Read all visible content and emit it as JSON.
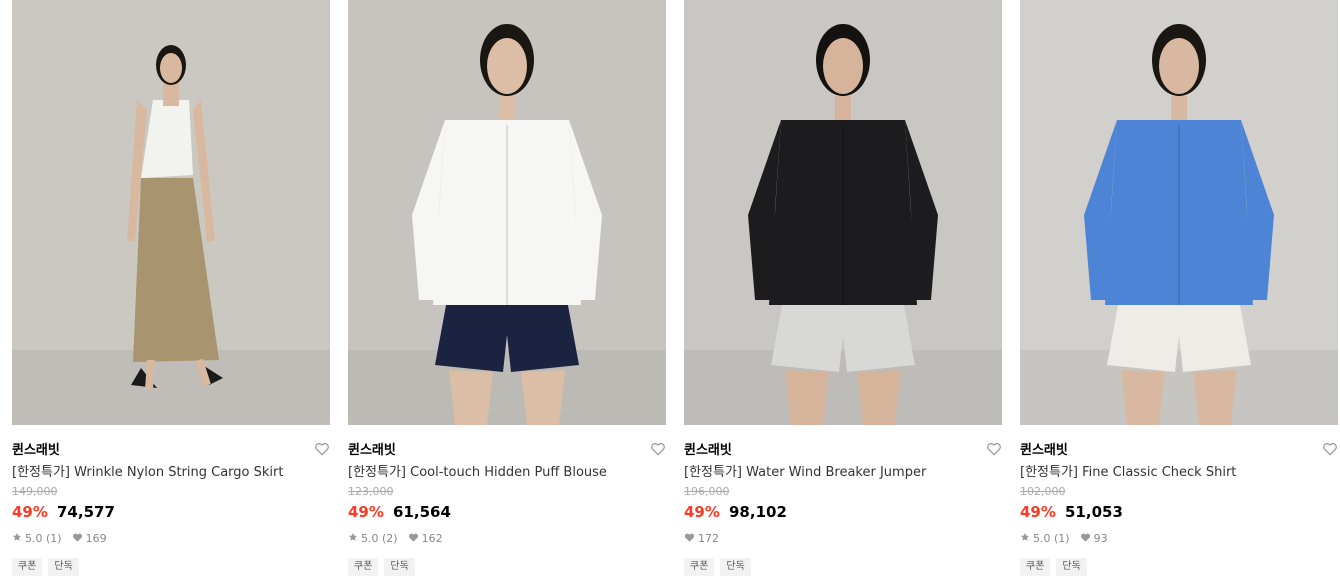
{
  "products": [
    {
      "brand": "퀸스래빗",
      "name": "[한정특가] Wrinkle Nylon String Cargo Skirt",
      "original_price": "149,000",
      "discount": "49%",
      "price": "74,577",
      "rating": "5.0 (1)",
      "likes": "169",
      "show_rating": true,
      "tags": [
        "쿠폰",
        "단독"
      ],
      "image": {
        "bg": "#cbc8c2",
        "top": "#f2f2ef",
        "bottom": "#a8946e",
        "bottom_type": "long-skirt",
        "hair": "#1a1612",
        "skin": "#d9b8a0"
      }
    },
    {
      "brand": "퀸스래빗",
      "name": "[한정특가] Cool-touch Hidden Puff Blouse",
      "original_price": "123,000",
      "discount": "49%",
      "price": "61,564",
      "rating": "5.0 (2)",
      "likes": "162",
      "show_rating": true,
      "tags": [
        "쿠폰",
        "단독"
      ],
      "image": {
        "bg": "#c7c4bf",
        "top": "#f6f6f4",
        "bottom": "#1c2340",
        "bottom_type": "shorts",
        "hair": "#1a1612",
        "skin": "#dcbda6"
      }
    },
    {
      "brand": "퀸스래빗",
      "name": "[한정특가] Water Wind Breaker Jumper",
      "original_price": "196,000",
      "discount": "49%",
      "price": "98,102",
      "rating": "",
      "likes": "172",
      "show_rating": false,
      "tags": [
        "쿠폰",
        "단독"
      ],
      "image": {
        "bg": "#c9c7c3",
        "top": "#1c1c1e",
        "bottom": "#d8d8d6",
        "bottom_type": "shorts",
        "hair": "#141210",
        "skin": "#d6b49c"
      }
    },
    {
      "brand": "퀸스래빗",
      "name": "[한정특가] Fine Classic Check Shirt",
      "original_price": "102,000",
      "discount": "49%",
      "price": "51,053",
      "rating": "5.0 (1)",
      "likes": "93",
      "show_rating": true,
      "tags": [
        "쿠폰",
        "단독"
      ],
      "image": {
        "bg": "#d2d0cc",
        "top": "#4d84d6",
        "bottom": "#eeece6",
        "bottom_type": "shorts",
        "hair": "#1a1612",
        "skin": "#d8b8a0"
      }
    }
  ]
}
